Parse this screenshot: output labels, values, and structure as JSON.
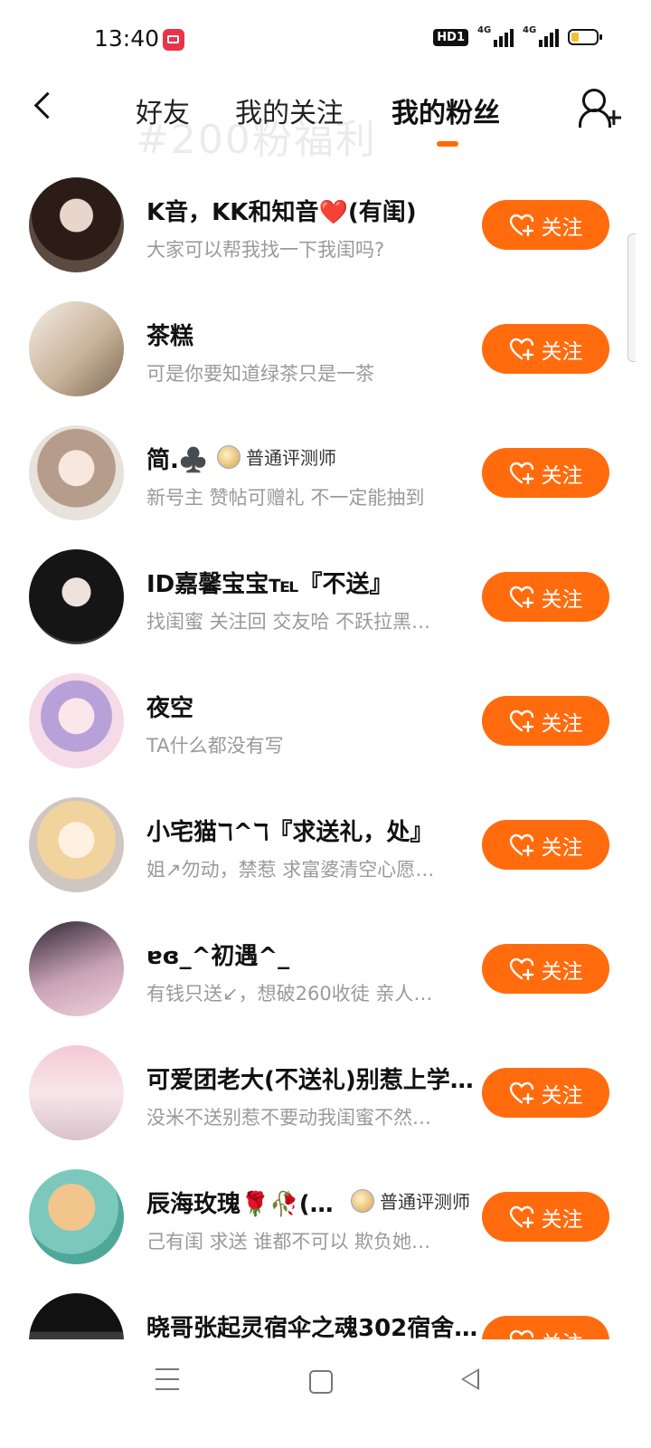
{
  "status_bar": {
    "time": "13:40",
    "hd": "HD1",
    "sig1_label": "4G",
    "sig2_label": "4G"
  },
  "header": {
    "tabs": [
      {
        "label": "好友"
      },
      {
        "label": "我的关注"
      },
      {
        "label": "我的粉丝"
      }
    ],
    "watermark": "#200粉福利"
  },
  "follow_label": "关注",
  "accent_color": "#ff6b0d",
  "fans": [
    {
      "name": "K音，KK和知音❤️(有闺)",
      "bio": "大家可以帮我找一下我闺吗?"
    },
    {
      "name": "茶糕",
      "bio": "可是你要知道绿茶只是一茶"
    },
    {
      "name": "简.♣️",
      "badge": "普通评测师",
      "bio": "新号主 赞帖可赠礼 不一定能抽到"
    },
    {
      "name": "ID嘉馨宝宝℡『不送』",
      "bio": "找闺蜜 关注回   交友哈 不跃拉黑…"
    },
    {
      "name": "夜空",
      "bio": "TA什么都没有写"
    },
    {
      "name": "小宅猫ℸ^ℸ『求送礼，处』",
      "bio": "姐↗勿动，禁惹 求富婆清空心愿…"
    },
    {
      "name": "ɐɞ_^初遇^_",
      "bio": "有钱只送↙，想破260收徒 亲人…"
    },
    {
      "name": "可爱团老大(不送礼)别惹上学…",
      "bio": "没米不送别惹不要动我闺蜜不然…"
    },
    {
      "name": "辰海玫瑰🌹🥀(…",
      "badge": "普通评测师",
      "bio": "己有闺 求送 谁都不可以 欺负她…"
    },
    {
      "name": "晓哥张起灵宿伞之魂302宿舍…",
      "bio": ""
    }
  ]
}
